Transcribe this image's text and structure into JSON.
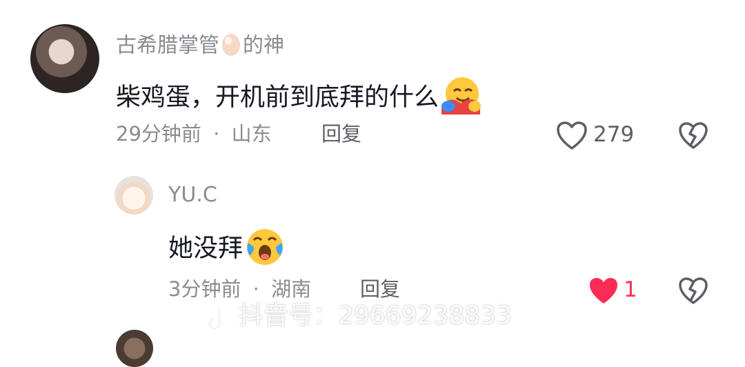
{
  "comment": {
    "author": "古希腊掌管",
    "author_suffix": "的神",
    "content": "柴鸡蛋，开机前到底拜的什么",
    "time": "29分钟前",
    "location": "山东",
    "reply_label": "回复",
    "likes": "279"
  },
  "reply": {
    "author": "YU.C",
    "content": "她没拜",
    "time": "3分钟前",
    "location": "湖南",
    "reply_label": "回复",
    "likes": "1"
  },
  "watermark": {
    "label": "抖音号：29669238833"
  },
  "next_comment": {
    "author": ""
  },
  "icons": {
    "author_badge": "egg-icon",
    "content_emoji": "hugging-face-icon",
    "reply_emoji": "crying-laughing-face-icon",
    "like": "heart-outline-icon",
    "liked": "heart-filled-icon",
    "dislike": "broken-heart-icon",
    "watermark": "tiktok-logo-icon"
  },
  "colors": {
    "liked_red": "#fe2c55",
    "meta_gray": "#8a8b91",
    "text_dark": "#161823"
  }
}
